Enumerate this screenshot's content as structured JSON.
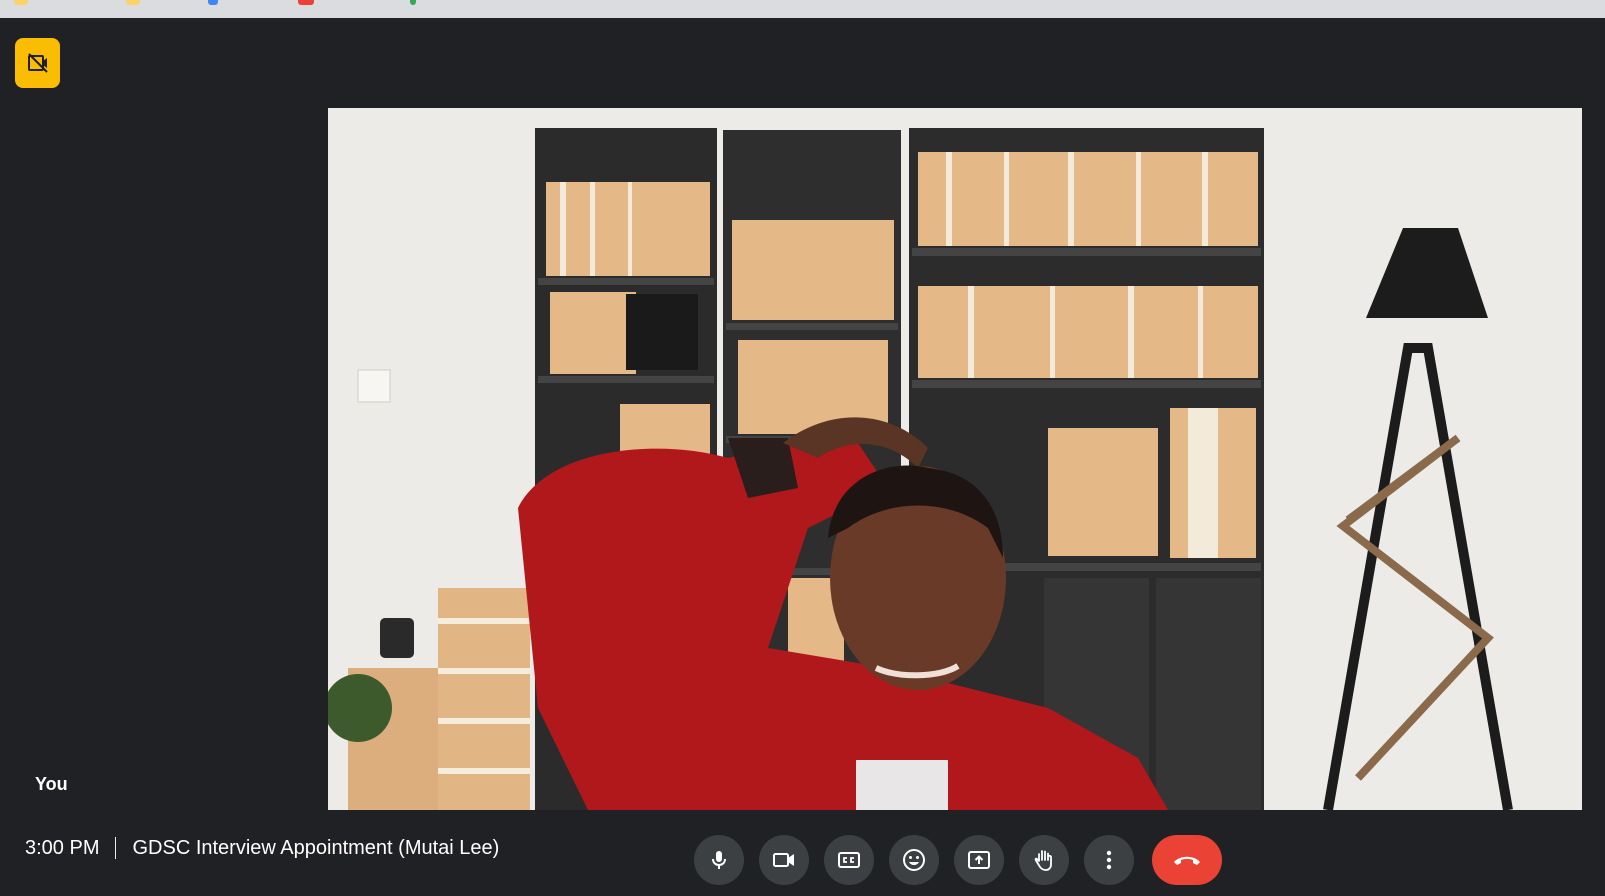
{
  "tile": {
    "self_label": "You"
  },
  "footer": {
    "time": "3:00 PM",
    "meeting_title": "GDSC Interview Appointment (Mutai Lee)"
  },
  "controls": [
    {
      "name": "microphone",
      "icon": "mic-icon"
    },
    {
      "name": "camera",
      "icon": "videocam-icon"
    },
    {
      "name": "captions",
      "icon": "closed-caption-icon"
    },
    {
      "name": "reactions",
      "icon": "emoji-icon"
    },
    {
      "name": "present",
      "icon": "present-screen-icon"
    },
    {
      "name": "raise-hand",
      "icon": "hand-icon"
    },
    {
      "name": "more-options",
      "icon": "more-vert-icon"
    },
    {
      "name": "leave-call",
      "icon": "call-end-icon"
    }
  ],
  "colors": {
    "background": "#202124",
    "control": "#3c4043",
    "leave_call": "#ea4335",
    "badge": "#fbbc04"
  }
}
